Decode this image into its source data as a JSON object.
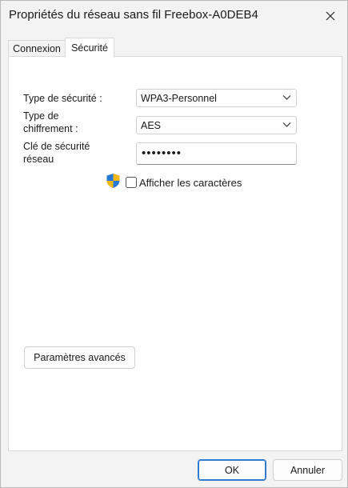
{
  "window": {
    "title": "Propriétés du réseau sans fil Freebox-A0DEB4",
    "close_icon": "close-icon"
  },
  "tabs": [
    {
      "label": "Connexion",
      "active": false
    },
    {
      "label": "Sécurité",
      "active": true
    }
  ],
  "security": {
    "type_label": "Type de sécurité :",
    "type_value": "WPA3-Personnel",
    "encryption_label_line1": "Type de",
    "encryption_label_line2": "chiffrement :",
    "encryption_value": "AES",
    "key_label_line1": "Clé de sécurité",
    "key_label_line2": "réseau",
    "key_value": "••••••••",
    "show_chars_label": "Afficher les caractères",
    "show_chars_checked": false,
    "advanced_button": "Paramètres avancés"
  },
  "footer": {
    "ok_label": "OK",
    "cancel_label": "Annuler"
  },
  "colors": {
    "accent": "#2f7bd0"
  }
}
